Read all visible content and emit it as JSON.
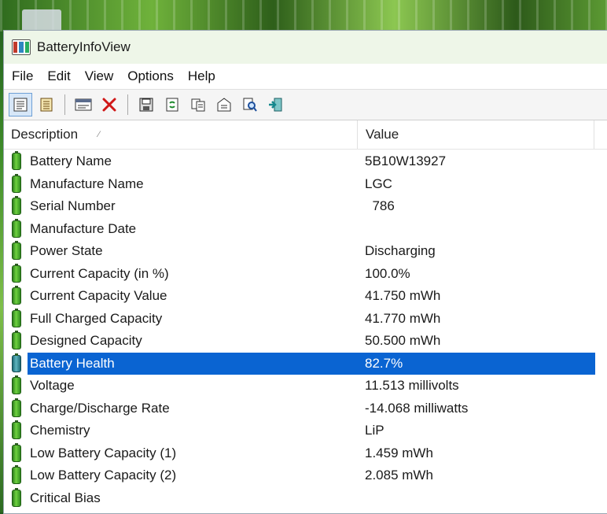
{
  "window": {
    "title": "BatteryInfoView"
  },
  "menu": [
    "File",
    "Edit",
    "View",
    "Options",
    "Help"
  ],
  "toolbar": {
    "buttons": [
      {
        "name": "properties-view-icon"
      },
      {
        "name": "html-report-icon"
      },
      {
        "name": "column-settings-icon"
      },
      {
        "name": "delete-icon"
      },
      {
        "name": "save-icon"
      },
      {
        "name": "refresh-icon"
      },
      {
        "name": "copy-icon"
      },
      {
        "name": "properties-icon"
      },
      {
        "name": "find-icon"
      },
      {
        "name": "exit-icon"
      }
    ]
  },
  "columns": {
    "description": "Description",
    "value": "Value"
  },
  "rows": [
    {
      "label": "Battery Name",
      "value": "5B10W13927"
    },
    {
      "label": "Manufacture Name",
      "value": "LGC"
    },
    {
      "label": "Serial Number",
      "value": "  786"
    },
    {
      "label": "Manufacture Date",
      "value": ""
    },
    {
      "label": "Power State",
      "value": "Discharging"
    },
    {
      "label": "Current Capacity (in %)",
      "value": "100.0%"
    },
    {
      "label": "Current Capacity Value",
      "value": "41.750 mWh"
    },
    {
      "label": "Full Charged Capacity",
      "value": "41.770 mWh"
    },
    {
      "label": "Designed Capacity",
      "value": "50.500 mWh"
    },
    {
      "label": "Battery Health",
      "value": "82.7%",
      "selected": true
    },
    {
      "label": "Voltage",
      "value": "11.513 millivolts"
    },
    {
      "label": "Charge/Discharge Rate",
      "value": "-14.068 milliwatts"
    },
    {
      "label": "Chemistry",
      "value": "LiP"
    },
    {
      "label": "Low Battery Capacity (1)",
      "value": "1.459 mWh"
    },
    {
      "label": "Low Battery Capacity (2)",
      "value": "2.085 mWh"
    },
    {
      "label": "Critical Bias",
      "value": ""
    }
  ],
  "colors": {
    "selection": "#0a64d2",
    "battery": "#4caf2a",
    "titlebar": "#eef6e8"
  }
}
